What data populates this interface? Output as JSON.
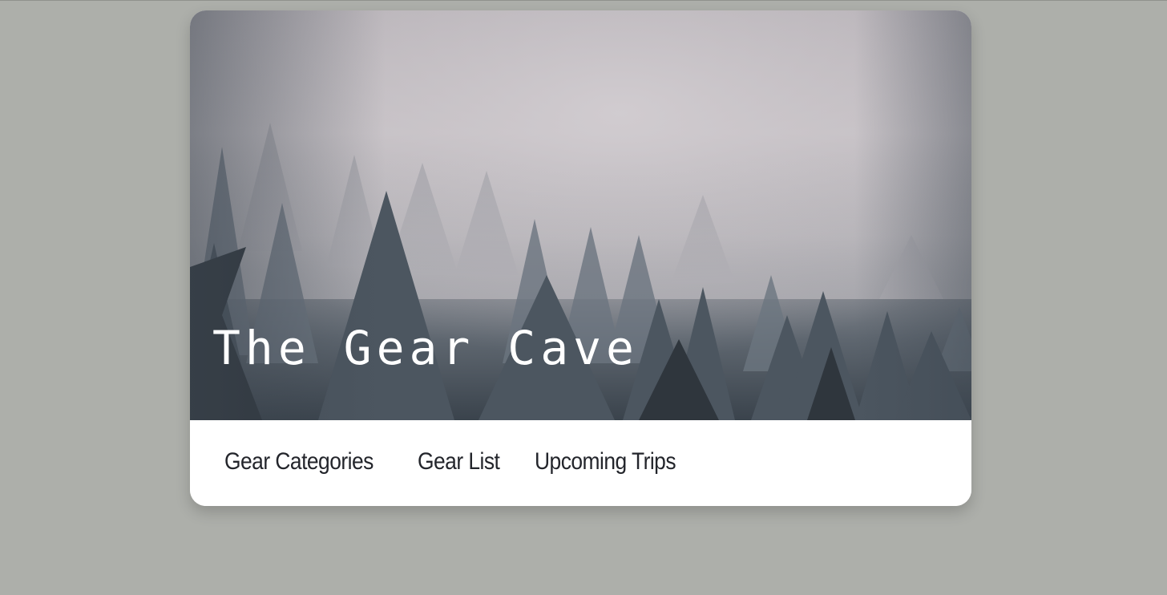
{
  "header": {
    "title": "The Gear Cave",
    "hero_image": "misty-pine-forest"
  },
  "nav": {
    "items": [
      {
        "label": "Gear Categories"
      },
      {
        "label": "Gear List"
      },
      {
        "label": "Upcoming Trips"
      }
    ]
  },
  "colors": {
    "page_background": "#adafaa",
    "card_background": "#ffffff",
    "title_text": "#ffffff",
    "nav_text": "#23252b"
  }
}
